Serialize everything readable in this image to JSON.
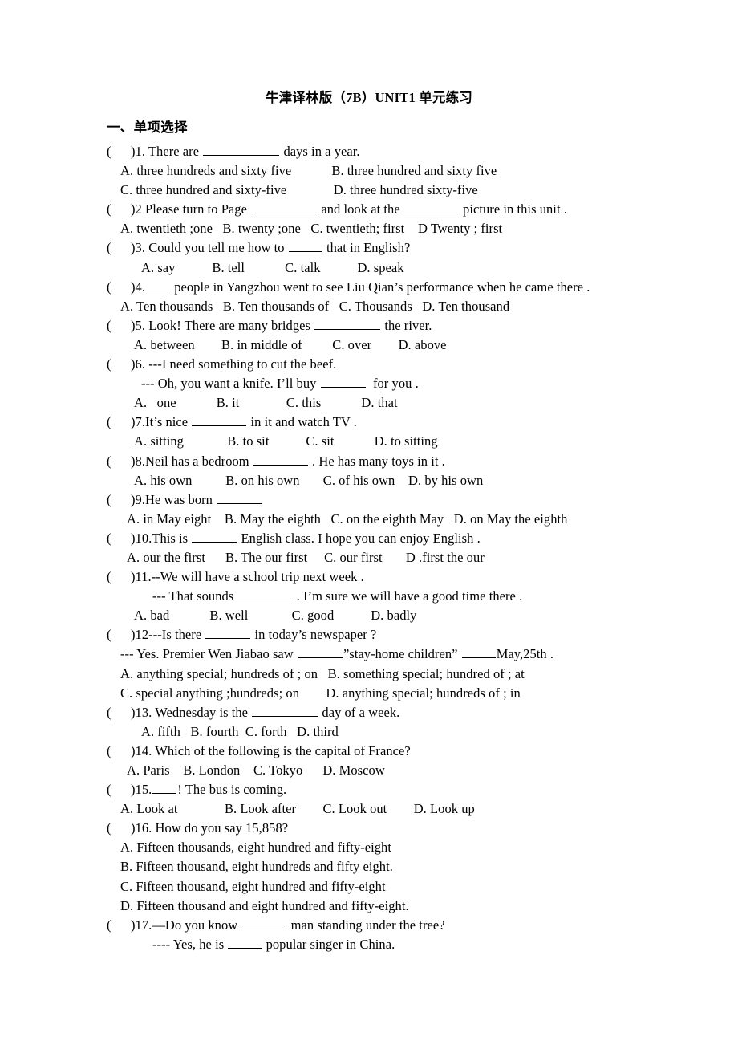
{
  "document": {
    "title": "牛津译林版（7B）UNIT1 单元练习",
    "section_heading": "一、单项选择"
  },
  "questions": [
    {
      "number": "1",
      "stem_pre": ")1. There are ",
      "stem_post": " days in a year.",
      "blank": "b-xxl",
      "option_lines": [
        "A. three hundreds and sixty five            B. three hundred and sixty five",
        "C. three hundred and sixty-five              D. three hundred sixty-five"
      ]
    },
    {
      "number": "2",
      "stem_pre": ")2 Please turn to Page ",
      "stem_mid": " and look at the ",
      "stem_post": " picture in this unit .",
      "blank": "b-xl",
      "blank2": "b-lg",
      "option_lines": [
        "A. twentieth ;one   B. twenty ;one   C. twentieth; first    D Twenty ; first"
      ]
    },
    {
      "number": "3",
      "stem_pre": ")3. Could you tell me how to ",
      "stem_post": " that in English?",
      "blank": "b-sm",
      "option_lines": [
        "A. say           B. tell            C. talk           D. speak"
      ]
    },
    {
      "number": "4",
      "stem_pre": ")4.",
      "stem_post": " people in Yangzhou went to see Liu Qian’s performance when he came there .",
      "blank": "b-xs",
      "option_lines": [
        "A. Ten thousands   B. Ten thousands of   C. Thousands   D. Ten thousand"
      ]
    },
    {
      "number": "5",
      "stem_pre": ")5. Look! There are many bridges ",
      "stem_post": " the river.",
      "blank": "b-xl",
      "option_lines": [
        "A. between        B. in middle of         C. over        D. above"
      ]
    },
    {
      "number": "6",
      "stem_pre": ")6. ---I need something to cut the beef.",
      "stem_post": "",
      "dialog_pre": "--- Oh, you want a knife. I’ll buy ",
      "dialog_post": "  for you .",
      "blank": "b-md",
      "option_lines": [
        "A.   one            B. it              C. this            D. that"
      ]
    },
    {
      "number": "7",
      "stem_pre": ")7.It’s nice ",
      "stem_post": " in it and watch TV .",
      "blank": "b-lg",
      "option_lines": [
        "A. sitting             B. to sit           C. sit            D. to sitting"
      ]
    },
    {
      "number": "8",
      "stem_pre": ")8.Neil has a bedroom ",
      "stem_post": " . He has many toys in it .",
      "blank": "b-lg",
      "option_lines": [
        "A. his own          B. on his own       C. of his own    D. by his own"
      ]
    },
    {
      "number": "9",
      "stem_pre": ")9.He was born ",
      "stem_post": "",
      "blank": "b-md",
      "option_lines": [
        "A. in May eight    B. May the eighth   C. on the eighth May   D. on May the eighth"
      ]
    },
    {
      "number": "10",
      "stem_pre": ")10.This is ",
      "stem_post": " English class. I hope you can enjoy English .",
      "blank": "b-md",
      "option_lines": [
        "A. our the first      B. The our first     C. our first       D .first the our"
      ]
    },
    {
      "number": "11",
      "stem_pre": ")11.--We will have a school trip next week .",
      "stem_post": "",
      "dialog_pre": "--- That sounds ",
      "dialog_post": " . I’m sure we will have a good time there .",
      "blank": "b-lg",
      "option_lines": [
        "A. bad            B. well             C. good           D. badly"
      ]
    },
    {
      "number": "12",
      "stem_pre": ")12---Is there ",
      "stem_post": " in today’s newspaper ?",
      "blank": "b-md",
      "dialog_pre": "--- Yes. Premier Wen Jiabao saw ",
      "dialog_mid": "”stay-home children” ",
      "dialog_post": "May,25th .",
      "option_lines": [
        "A. anything special; hundreds of ; on   B. something special; hundred of ; at",
        "C. special anything ;hundreds; on        D. anything special; hundreds of ; in"
      ]
    },
    {
      "number": "13",
      "stem_pre": ")13. Wednesday is the ",
      "stem_post": " day of a week.",
      "blank": "b-xl",
      "option_lines": [
        "A. fifth   B. fourth  C. forth   D. third"
      ]
    },
    {
      "number": "14",
      "stem_pre": ")14. Which of the following is the capital of France?",
      "stem_post": "",
      "option_lines": [
        "A. Paris    B. London    C. Tokyo      D. Moscow"
      ]
    },
    {
      "number": "15",
      "stem_pre": ")15.",
      "stem_post": "! The bus is coming.",
      "blank": "b-xs",
      "option_lines": [
        "A. Look at              B. Look after        C. Look out        D. Look up"
      ]
    },
    {
      "number": "16",
      "stem_pre": ")16. How do you say 15,858?",
      "stem_post": "",
      "option_lines": [
        "A. Fifteen thousands, eight hundred and fifty-eight",
        "B. Fifteen thousand, eight hundreds and fifty eight.",
        "C. Fifteen thousand, eight hundred and fifty-eight",
        "D. Fifteen thousand and eight hundred and fifty-eight."
      ]
    },
    {
      "number": "17",
      "stem_pre": ")17.—Do you know ",
      "stem_post": " man standing under the tree?",
      "blank": "b-md",
      "dialog_pre": "---- Yes, he is ",
      "dialog_post": " popular singer in China.",
      "blank2": "b-sm"
    }
  ]
}
